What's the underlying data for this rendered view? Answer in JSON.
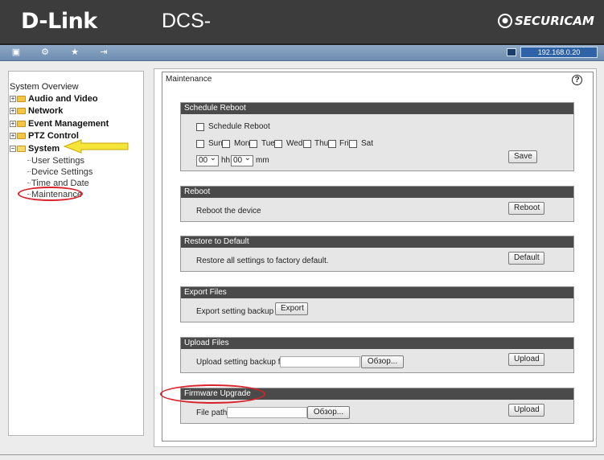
{
  "header": {
    "logo": "D-Link",
    "model": "DCS-",
    "brand": "SECURICAM"
  },
  "toolbar": {
    "ip": "192.168.0.20",
    "icons": [
      "camera-icon",
      "settings-icon",
      "star-icon",
      "exit-icon"
    ]
  },
  "sidebar": {
    "root": "System Overview",
    "items": [
      {
        "label": "Audio and Video"
      },
      {
        "label": "Network"
      },
      {
        "label": "Event Management"
      },
      {
        "label": "PTZ Control"
      },
      {
        "label": "System"
      }
    ],
    "system_children": [
      "User Settings",
      "Device Settings",
      "Time and Date",
      "Maintenance"
    ]
  },
  "main": {
    "title": "Maintenance",
    "help": "?",
    "schedule": {
      "header": "Schedule Reboot",
      "enable_label": "Schedule Reboot",
      "days": [
        "Sun",
        "Mon",
        "Tue",
        "Wed",
        "Thu",
        "Fri",
        "Sat"
      ],
      "hour": "00",
      "hour_unit": "hh",
      "minute": "00",
      "minute_unit": "mm",
      "save": "Save"
    },
    "reboot": {
      "header": "Reboot",
      "text": "Reboot the device",
      "button": "Reboot"
    },
    "restore": {
      "header": "Restore to Default",
      "text": "Restore all settings to factory default.",
      "button": "Default"
    },
    "export": {
      "header": "Export Files",
      "text": "Export setting backup file",
      "button": "Export"
    },
    "upload": {
      "header": "Upload Files",
      "text": "Upload setting backup file",
      "browse": "Обзор...",
      "button": "Upload"
    },
    "firmware": {
      "header": "Firmware Upgrade",
      "text": "File path",
      "browse": "Обзор...",
      "button": "Upload"
    }
  },
  "colors": {
    "header_bg": "#3c3c3c",
    "toolbar": "#7d9bbd",
    "section_head": "#4a4a4a",
    "annotation": "#d9232b",
    "arrow": "#f5e43a"
  }
}
